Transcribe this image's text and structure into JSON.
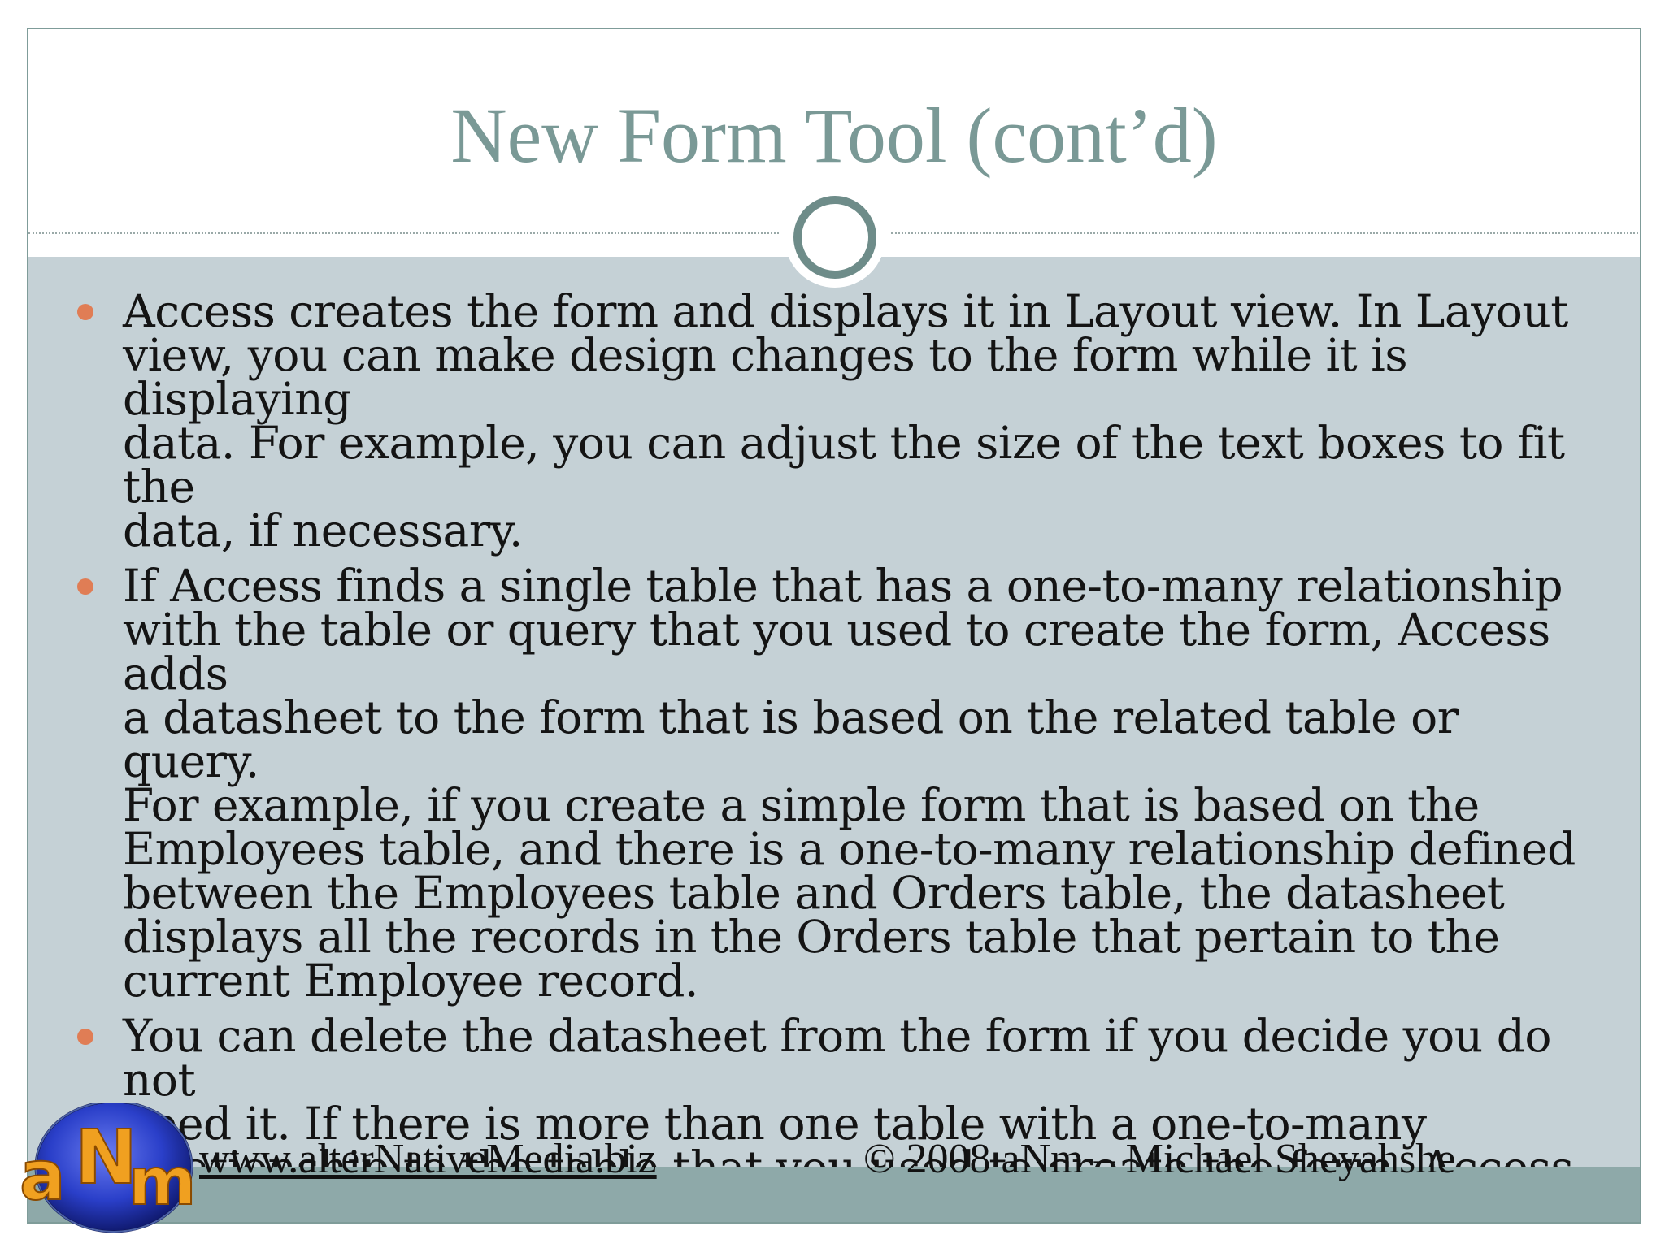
{
  "slide": {
    "title": "New Form Tool (cont’d)",
    "bullets": [
      "Access creates the form and displays it in Layout view. In Layout\nview, you can make design changes to the form while it is displaying\ndata. For example, you can adjust the size of the text boxes to fit the\ndata, if necessary.",
      "If Access finds a single table that has a one-to-many relationship\nwith the table or query that you used to create the form, Access adds\na datasheet to the form that is based on the related table or query.\nFor example, if you create a simple form that is based on the\nEmployees table, and there is a one-to-many relationship defined\nbetween the Employees table and Orders table, the datasheet\ndisplays all the records in the Orders table that pertain to the\ncurrent Employee record.",
      "You can delete the datasheet from the form if you decide you do not\nneed it. If there is more than one table with a one-to-many\nrelationship to the table that you used to create the form, Access\ndoes not add any datasheets to the form."
    ]
  },
  "footer": {
    "url": "www.alterNativeMedia.biz",
    "copyright": "© 2008 aNm – Michael Sheyahshe"
  },
  "logo": {
    "text": "aNm",
    "colors": {
      "globe": "#2a3fc9",
      "letters": "#f0a020"
    }
  },
  "colors": {
    "title": "#7a9996",
    "body_background": "#c5d1d6",
    "bullet": "#e07d55",
    "footer_bar": "#8ea9a9",
    "ring": "#6e8c89"
  }
}
